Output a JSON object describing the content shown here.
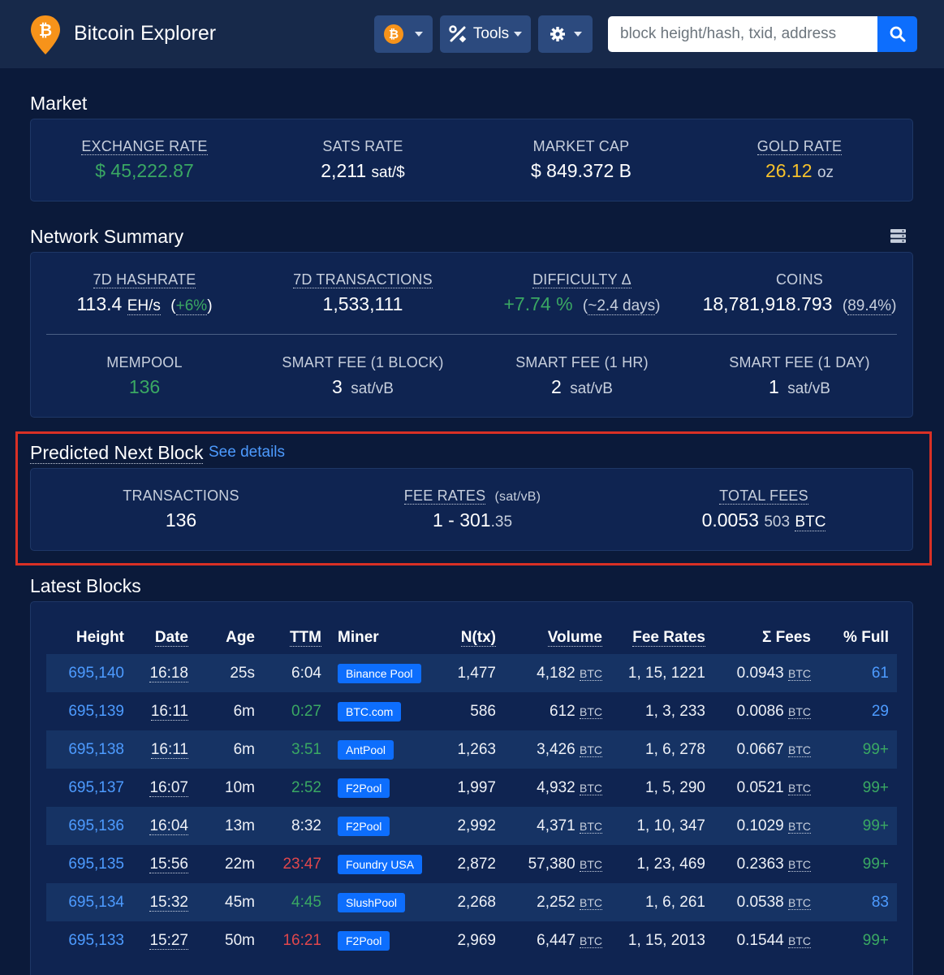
{
  "nav": {
    "title": "Bitcoin Explorer",
    "tools_label": "Tools",
    "search_placeholder": "block height/hash, txid, address",
    "coin_symbol": "₿"
  },
  "market": {
    "title": "Market",
    "exchange_rate": {
      "label": "EXCHANGE RATE",
      "value": "$ 45,222.87"
    },
    "sats_rate": {
      "label": "SATS RATE",
      "value": "2,211",
      "unit": "sat/$"
    },
    "market_cap": {
      "label": "MARKET CAP",
      "value": "$ 849.372 B"
    },
    "gold_rate": {
      "label": "GOLD RATE",
      "value": "26.12",
      "unit": "oz"
    }
  },
  "network": {
    "title": "Network Summary",
    "hashrate": {
      "label": "7D HASHRATE",
      "value": "113.4",
      "unit": "EH/s",
      "change": "+6%"
    },
    "transactions": {
      "label": "7D TRANSACTIONS",
      "value": "1,533,111"
    },
    "difficulty": {
      "label": "DIFFICULTY Δ",
      "value": "+7.74 %",
      "eta": "~2.4 days"
    },
    "coins": {
      "label": "COINS",
      "value": "18,781,918.793",
      "pct": "89.4%"
    },
    "mempool": {
      "label": "MEMPOOL",
      "value": "136"
    },
    "fee_1block": {
      "label": "SMART FEE (1 BLOCK)",
      "value": "3",
      "unit": "sat/vB"
    },
    "fee_1hr": {
      "label": "SMART FEE (1 HR)",
      "value": "2",
      "unit": "sat/vB"
    },
    "fee_1day": {
      "label": "SMART FEE (1 DAY)",
      "value": "1",
      "unit": "sat/vB"
    }
  },
  "predicted": {
    "title": "Predicted Next Block",
    "link": "See details",
    "transactions": {
      "label": "TRANSACTIONS",
      "value": "136"
    },
    "fee_rates": {
      "label": "FEE RATES",
      "unit": "(sat/vB)",
      "value": "1 - 301",
      "decimals": ".35"
    },
    "total_fees": {
      "label": "TOTAL FEES",
      "value": "0.0053",
      "small": "503",
      "unit": "BTC"
    }
  },
  "latest": {
    "title": "Latest Blocks",
    "columns": [
      "Height",
      "Date",
      "Age",
      "TTM",
      "Miner",
      "N(tx)",
      "Volume",
      "Fee Rates",
      "Σ Fees",
      "% Full"
    ],
    "rows": [
      {
        "height": "695,140",
        "date": "16:18",
        "age": "25s",
        "ttm": "6:04",
        "ttm_color": "white",
        "miner": "Binance Pool",
        "ntx": "1,477",
        "volume": "4,182",
        "fee_rates": "1, 15, 1221",
        "fees": "0.0943",
        "full": "61",
        "full_color": "blue"
      },
      {
        "height": "695,139",
        "date": "16:11",
        "age": "6m",
        "ttm": "0:27",
        "ttm_color": "green",
        "miner": "BTC.com",
        "ntx": "586",
        "volume": "612",
        "fee_rates": "1, 3, 233",
        "fees": "0.0086",
        "full": "29",
        "full_color": "blue"
      },
      {
        "height": "695,138",
        "date": "16:11",
        "age": "6m",
        "ttm": "3:51",
        "ttm_color": "green",
        "miner": "AntPool",
        "ntx": "1,263",
        "volume": "3,426",
        "fee_rates": "1, 6, 278",
        "fees": "0.0667",
        "full": "99+",
        "full_color": "green"
      },
      {
        "height": "695,137",
        "date": "16:07",
        "age": "10m",
        "ttm": "2:52",
        "ttm_color": "green",
        "miner": "F2Pool",
        "ntx": "1,997",
        "volume": "4,932",
        "fee_rates": "1, 5, 290",
        "fees": "0.0521",
        "full": "99+",
        "full_color": "green"
      },
      {
        "height": "695,136",
        "date": "16:04",
        "age": "13m",
        "ttm": "8:32",
        "ttm_color": "white",
        "miner": "F2Pool",
        "ntx": "2,992",
        "volume": "4,371",
        "fee_rates": "1, 10, 347",
        "fees": "0.1029",
        "full": "99+",
        "full_color": "green"
      },
      {
        "height": "695,135",
        "date": "15:56",
        "age": "22m",
        "ttm": "23:47",
        "ttm_color": "red",
        "miner": "Foundry USA",
        "ntx": "2,872",
        "volume": "57,380",
        "fee_rates": "1, 23, 469",
        "fees": "0.2363",
        "full": "99+",
        "full_color": "green"
      },
      {
        "height": "695,134",
        "date": "15:32",
        "age": "45m",
        "ttm": "4:45",
        "ttm_color": "green",
        "miner": "SlushPool",
        "ntx": "2,268",
        "volume": "2,252",
        "fee_rates": "1, 6, 261",
        "fees": "0.0538",
        "full": "83",
        "full_color": "blue"
      },
      {
        "height": "695,133",
        "date": "15:27",
        "age": "50m",
        "ttm": "16:21",
        "ttm_color": "red",
        "miner": "F2Pool",
        "ntx": "2,969",
        "volume": "6,447",
        "fee_rates": "1, 15, 2013",
        "fees": "0.1544",
        "full": "99+",
        "full_color": "green"
      }
    ],
    "unit": "BTC"
  }
}
